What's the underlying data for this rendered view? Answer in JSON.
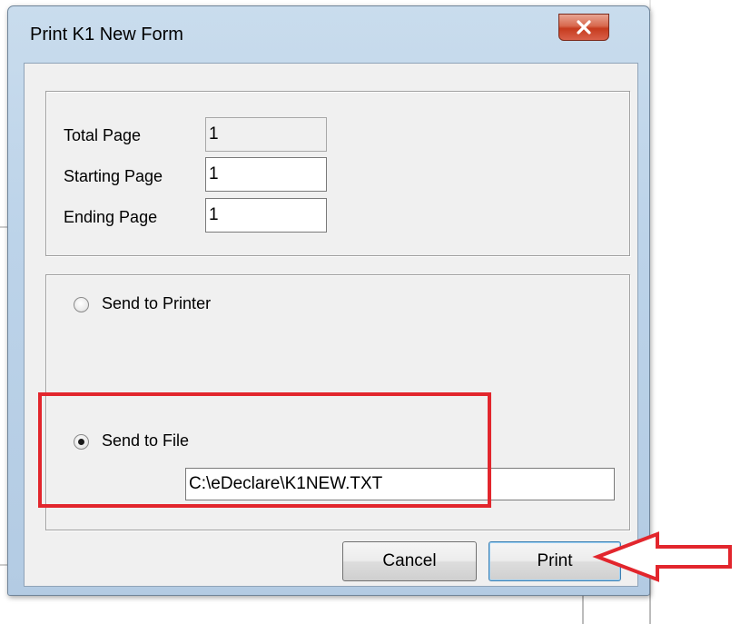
{
  "window": {
    "title": "Print K1 New Form",
    "close_label": "x"
  },
  "pages": {
    "total_label": "Total Page",
    "total_value": "1",
    "start_label": "Starting Page",
    "start_value": "1",
    "end_label": "Ending Page",
    "end_value": "1"
  },
  "output": {
    "printer_label": "Send to Printer",
    "printer_selected": false,
    "file_label": "Send to File",
    "file_selected": true,
    "file_path": "C:\\eDeclare\\K1NEW.TXT"
  },
  "buttons": {
    "cancel_label": "Cancel",
    "print_label": "Print"
  },
  "annotations": {
    "highlight_color": "#e2262d",
    "arrow_color": "#e2262d"
  }
}
